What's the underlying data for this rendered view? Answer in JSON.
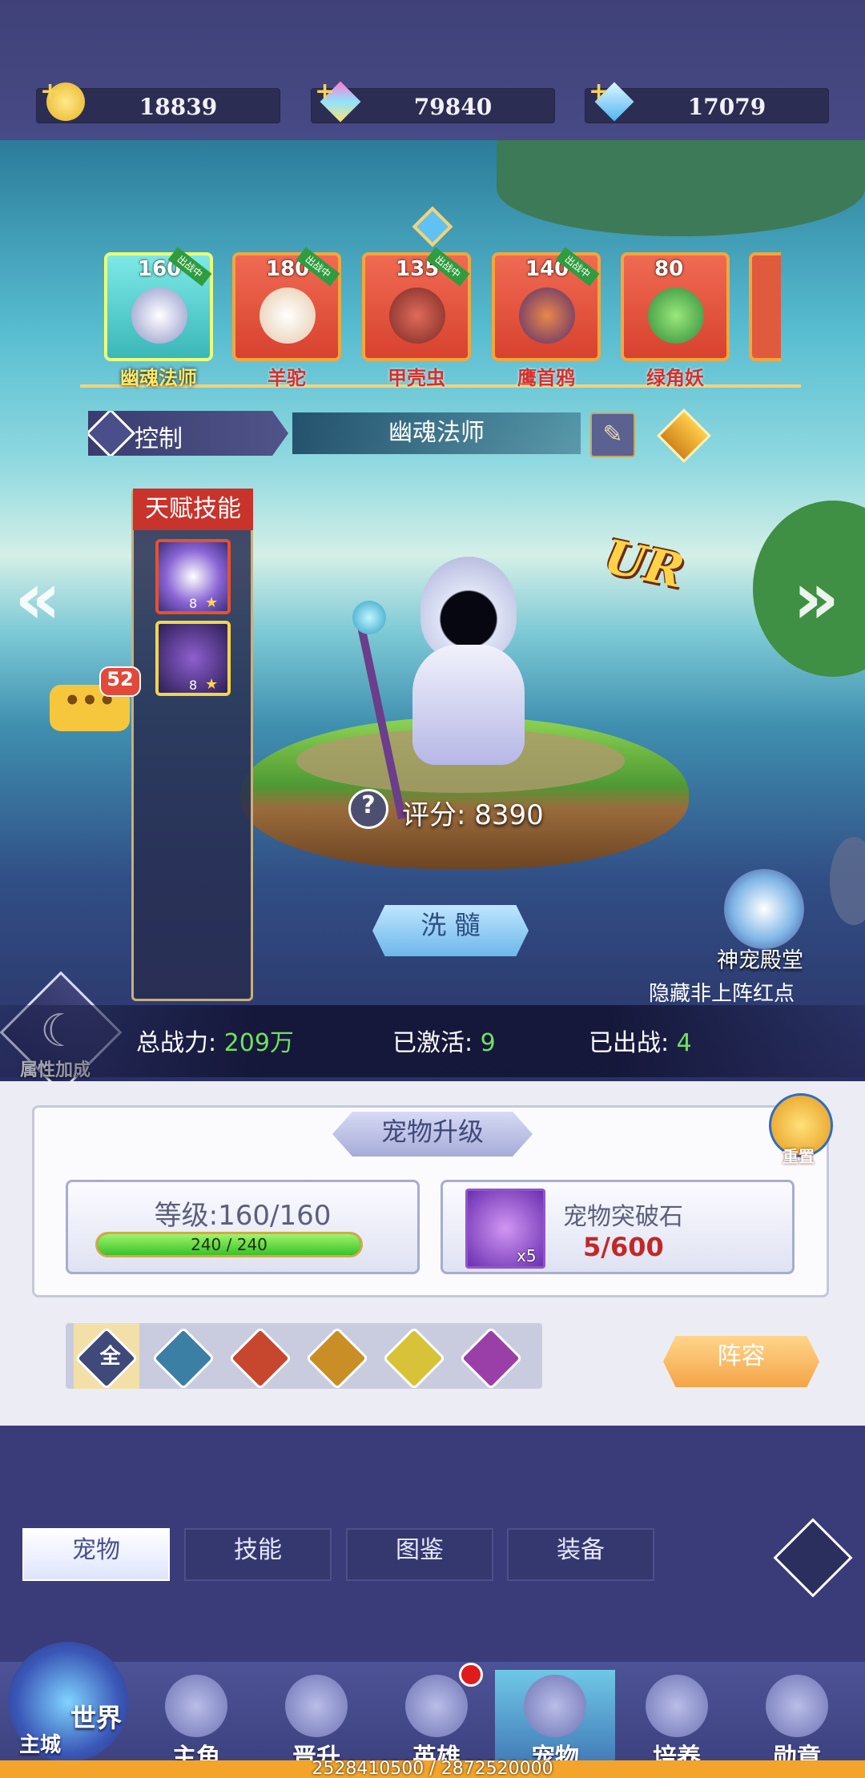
{
  "currencies": [
    {
      "icon": "gold-coin-icon",
      "value": "18839"
    },
    {
      "icon": "rainbow-gem-icon",
      "value": "79840"
    },
    {
      "icon": "blue-diamond-icon",
      "value": "17079"
    }
  ],
  "roster": [
    {
      "level": "160",
      "status": "出战中",
      "name": "幽魂法师",
      "selected": true
    },
    {
      "level": "180",
      "status": "出战中",
      "name": "羊驼"
    },
    {
      "level": "135",
      "status": "出战中",
      "name": "甲壳虫"
    },
    {
      "level": "140",
      "status": "出战中",
      "name": "鹰首鸦"
    },
    {
      "level": "80",
      "status": "",
      "name": "绿角妖"
    }
  ],
  "pet_header": {
    "type_label": "控制",
    "name": "幽魂法师"
  },
  "talent": {
    "title": "天赋技能",
    "skills": [
      {
        "stars": "8"
      },
      {
        "stars": "8"
      }
    ]
  },
  "chat_badge": "52",
  "rarity": "UR",
  "score": {
    "label": "评分:",
    "value": "8390"
  },
  "wash_button": "洗 髓",
  "temple": {
    "label": "神宠殿堂"
  },
  "hide_red_dot": "隐藏非上阵红点",
  "attribute_bonus": "属性加成",
  "stats": {
    "power_label": "总战力:",
    "power_value": "209万",
    "activated_label": "已激活:",
    "activated_value": "9",
    "deployed_label": "已出战:",
    "deployed_value": "4"
  },
  "upgrade": {
    "title": "宠物升级",
    "reset_label": "重置",
    "level_label": "等级:",
    "level_value": "160/160",
    "exp_text": "240 / 240",
    "exp_progress": 1.0,
    "stone_name": "宠物突破石",
    "stone_count": "5/600",
    "stone_qty": "x5"
  },
  "filters": [
    {
      "label": "全",
      "color": "#3f4a7a"
    },
    {
      "label": "",
      "icon": "water-icon",
      "color": "#3c7fa5"
    },
    {
      "label": "",
      "icon": "fire-icon",
      "color": "#c7462e"
    },
    {
      "label": "",
      "icon": "earth-icon",
      "color": "#c98e25"
    },
    {
      "label": "",
      "icon": "light-icon",
      "color": "#d7c238"
    },
    {
      "label": "",
      "icon": "dark-icon",
      "color": "#9a3fa8"
    }
  ],
  "lineup_button": "阵容",
  "subtabs": [
    "宠物",
    "技能",
    "图鉴",
    "装备"
  ],
  "nav": {
    "world_label": "世界",
    "city_label": "主城",
    "items": [
      "主角",
      "晋升",
      "英雄",
      "宠物",
      "培养",
      "勋章"
    ]
  },
  "footer_numbers": "2528410500 / 2872520000"
}
